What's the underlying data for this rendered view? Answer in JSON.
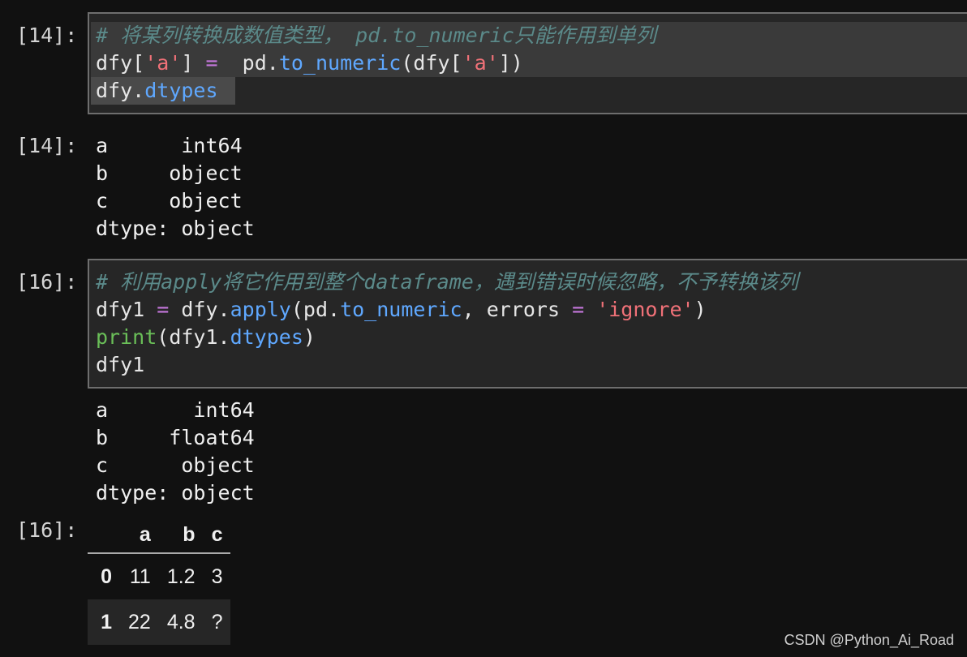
{
  "cells": [
    {
      "in_prompt": "[14]:",
      "comment": "# 将某列转换成数值类型， pd.to_numeric只能作用到单列",
      "line2": {
        "a": "dfy[",
        "b": "'a'",
        "c": "] ",
        "d": "=",
        "e": "  pd.",
        "f": "to_numeric",
        "g": "(dfy[",
        "h": "'a'",
        "i": "])"
      },
      "line3": {
        "a": "dfy.",
        "b": "dtypes",
        "c": " "
      },
      "out_prompt": "[14]:",
      "output": [
        "a      int64",
        "b     object",
        "c     object",
        "dtype: object"
      ]
    },
    {
      "in_prompt": "[16]:",
      "comment": "# 利用apply将它作用到整个dataframe，遇到错误时候忽略，不予转换该列",
      "line2": {
        "a": "dfy1 ",
        "b": "=",
        "c": " dfy.",
        "d": "apply",
        "e": "(pd.",
        "f": "to_numeric",
        "g": ", errors ",
        "h": "=",
        "i": " ",
        "j": "'ignore'",
        "k": ")"
      },
      "line3": {
        "a": "print",
        "b": "(dfy1.",
        "c": "dtypes",
        "d": ")"
      },
      "line4": "dfy1",
      "output": [
        "a       int64",
        "b     float64",
        "c      object",
        "dtype: object"
      ],
      "out_prompt": "[16]:"
    }
  ],
  "dataframe": {
    "columns": [
      "",
      "a",
      "b",
      "c"
    ],
    "rows": [
      [
        "0",
        "11",
        "1.2",
        "3"
      ],
      [
        "1",
        "22",
        "4.8",
        "?"
      ]
    ]
  },
  "watermark": "CSDN @Python_Ai_Road"
}
